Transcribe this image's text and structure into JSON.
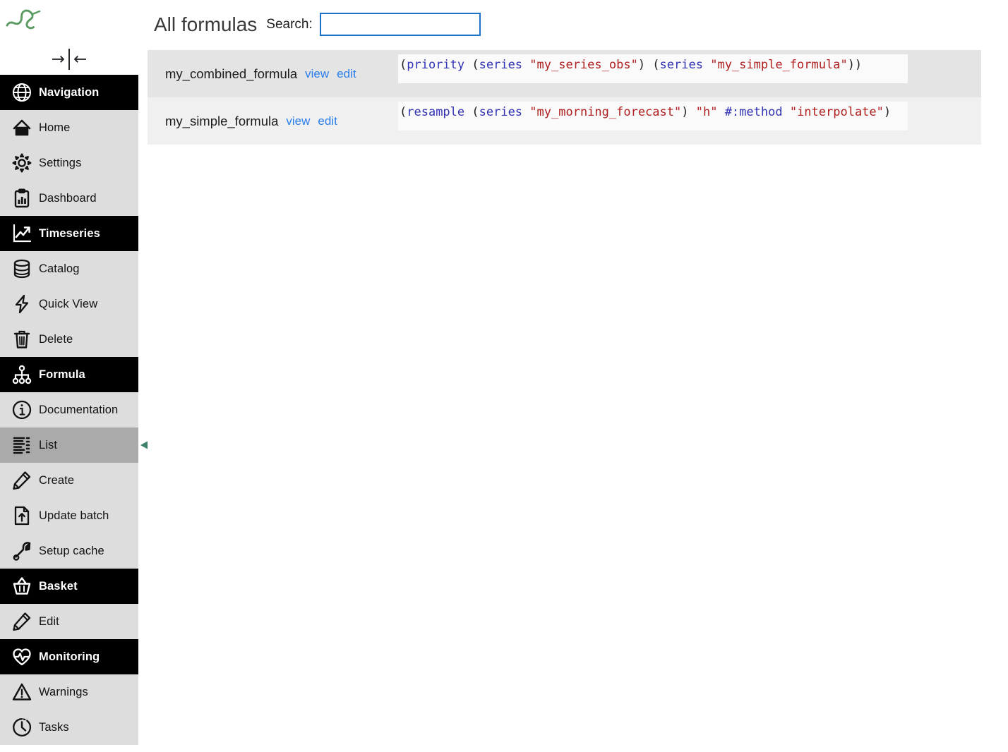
{
  "app": {
    "logo_name": "snake-logo",
    "collapse_toggle": {
      "expand_glyph": "→",
      "collapse_glyph": "←",
      "name": "sidebar-collapse-toggle"
    }
  },
  "sidebar": {
    "items": [
      {
        "label": "Navigation",
        "icon": "globe-icon",
        "theme": "theme-dark"
      },
      {
        "label": "Home",
        "icon": "home-icon",
        "theme": "theme-light"
      },
      {
        "label": "Settings",
        "icon": "gear-icon",
        "theme": "theme-light"
      },
      {
        "label": "Dashboard",
        "icon": "dashboard-icon",
        "theme": "theme-light"
      },
      {
        "label": "Timeseries",
        "icon": "trending-up-icon",
        "theme": "theme-dark"
      },
      {
        "label": "Catalog",
        "icon": "database-icon",
        "theme": "theme-light"
      },
      {
        "label": "Quick View",
        "icon": "lightning-icon",
        "theme": "theme-light"
      },
      {
        "label": "Delete",
        "icon": "trash-icon",
        "theme": "theme-light"
      },
      {
        "label": "Formula",
        "icon": "sitemap-icon",
        "theme": "theme-dark"
      },
      {
        "label": "Documentation",
        "icon": "info-icon",
        "theme": "theme-light"
      },
      {
        "label": "List",
        "icon": "list-icon",
        "theme": "theme-selected"
      },
      {
        "label": "Create",
        "icon": "pencil-icon",
        "theme": "theme-light"
      },
      {
        "label": "Update batch",
        "icon": "file-upload-icon",
        "theme": "theme-light"
      },
      {
        "label": "Setup cache",
        "icon": "wrench-icon",
        "theme": "theme-light"
      },
      {
        "label": "Basket",
        "icon": "basket-icon",
        "theme": "theme-dark"
      },
      {
        "label": "Edit",
        "icon": "pencil-icon",
        "theme": "theme-light"
      },
      {
        "label": "Monitoring",
        "icon": "heartbeat-icon",
        "theme": "theme-dark"
      },
      {
        "label": "Warnings",
        "icon": "warning-icon",
        "theme": "theme-light"
      },
      {
        "label": "Tasks",
        "icon": "clock-icon",
        "theme": "theme-light"
      }
    ]
  },
  "annotation": {
    "arrow_name": "green-pointer-arrow",
    "arrow_color": "#3d8168",
    "points_at": "List"
  },
  "main": {
    "title": "All formulas",
    "search": {
      "label": "Search:",
      "value": "",
      "placeholder": ""
    },
    "table": {
      "rows": [
        {
          "name": "my_combined_formula",
          "view_label": "view",
          "edit_label": "edit",
          "code": "(priority (series \"my_series_obs\") (series \"my_simple_formula\"))",
          "code_tokens": [
            {
              "t": "(",
              "c": "tok-paren"
            },
            {
              "t": "priority",
              "c": "tok-op"
            },
            {
              "t": " (",
              "c": "tok-paren"
            },
            {
              "t": "series",
              "c": "tok-op"
            },
            {
              "t": " ",
              "c": "tok-paren"
            },
            {
              "t": "\"my_series_obs\"",
              "c": "tok-str"
            },
            {
              "t": ") (",
              "c": "tok-paren"
            },
            {
              "t": "series",
              "c": "tok-op"
            },
            {
              "t": " ",
              "c": "tok-paren"
            },
            {
              "t": "\"my_simple_formula\"",
              "c": "tok-str"
            },
            {
              "t": "))",
              "c": "tok-paren"
            }
          ]
        },
        {
          "name": "my_simple_formula",
          "view_label": "view",
          "edit_label": "edit",
          "code": "(resample (series \"my_morning_forecast\") \"h\" #:method \"interpolate\")",
          "code_tokens": [
            {
              "t": "(",
              "c": "tok-paren"
            },
            {
              "t": "resample",
              "c": "tok-op"
            },
            {
              "t": " (",
              "c": "tok-paren"
            },
            {
              "t": "series",
              "c": "tok-op"
            },
            {
              "t": " ",
              "c": "tok-paren"
            },
            {
              "t": "\"my_morning_forecast\"",
              "c": "tok-str"
            },
            {
              "t": ") ",
              "c": "tok-paren"
            },
            {
              "t": "\"h\"",
              "c": "tok-str"
            },
            {
              "t": " ",
              "c": "tok-paren"
            },
            {
              "t": "#:method",
              "c": "tok-kw"
            },
            {
              "t": " ",
              "c": "tok-paren"
            },
            {
              "t": "\"interpolate\"",
              "c": "tok-str"
            },
            {
              "t": ")",
              "c": "tok-paren"
            }
          ]
        }
      ]
    }
  },
  "colors": {
    "sidebar_light": "#dddddd",
    "sidebar_dark": "#000000",
    "sidebar_selected": "#aaaaaa",
    "link_blue": "#2a7fea",
    "search_border": "#1a73c8",
    "arrow_green": "#3d8168",
    "row_alt": "#e4e4e4",
    "row_base": "#f0f0f0",
    "code_bg": "#fafafa",
    "token_op": "#3232b4",
    "token_str": "#b02020"
  }
}
